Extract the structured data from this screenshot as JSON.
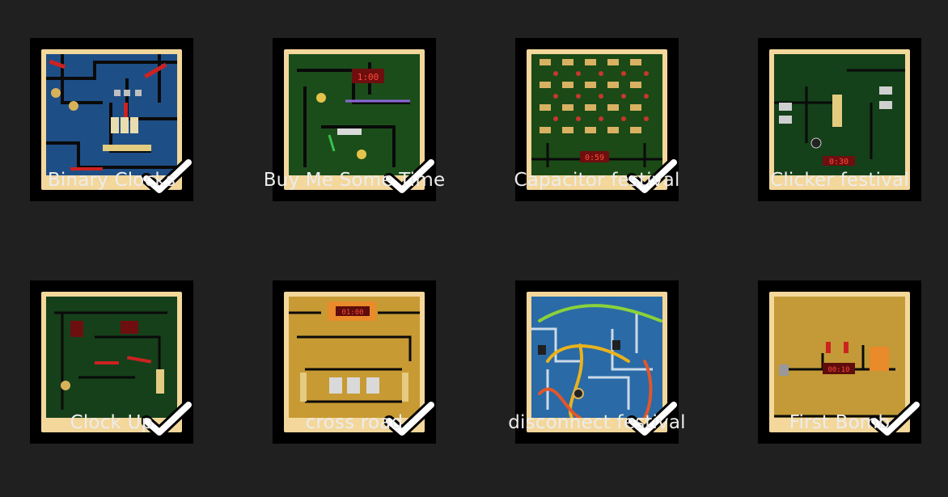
{
  "levels": [
    {
      "title": "Binary Clocks",
      "completed": true,
      "board_color": "#1e4e86"
    },
    {
      "title": "Buy Me Some Time",
      "completed": true,
      "board_color": "#1b4d1b"
    },
    {
      "title": "Capacitor festival",
      "completed": true,
      "board_color": "#1b4a16"
    },
    {
      "title": "Clicker festival",
      "completed": true,
      "board_color": "#14401a"
    },
    {
      "title": "Clock Up",
      "completed": true,
      "board_color": "#15401a"
    },
    {
      "title": "cross road",
      "completed": true,
      "board_color": "#c79a33"
    },
    {
      "title": "disconnect festival",
      "completed": true,
      "board_color": "#2a6aa6"
    },
    {
      "title": "First Bomb",
      "completed": true,
      "board_color": "#c39a37"
    }
  ],
  "displays": {
    "buy_me_some_time": "1:00",
    "capacitor_festival": "0:59",
    "clicker_festival": "0:30",
    "cross_road": "01:00",
    "first_bomb": "00:10"
  },
  "icons": {
    "completed": "check-icon"
  },
  "colors": {
    "background": "#202020",
    "frame": "#000000",
    "paper": "#f3d79b",
    "trace": "#0a0a0a"
  }
}
